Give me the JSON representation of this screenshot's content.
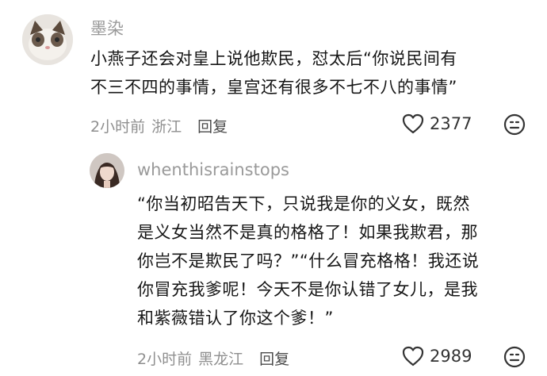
{
  "comment": {
    "username": "墨染",
    "text_lines": [
      "小燕子还会对皇上说他欺民，怼太后“你说民间有",
      "不三不四的事情，皇宫还有很多不七不八的事情”"
    ],
    "time": "2小时前",
    "location": "浙江",
    "reply_label": "回复",
    "like_count": "2377",
    "avatar_icon": "cat-avatar",
    "like_icon": "heart-outline-icon",
    "dislike_icon": "frown-face-icon"
  },
  "reply": {
    "username": "whenthisrainstops",
    "text_lines": [
      "“你当初昭告天下，只说我是你的义女，既然",
      "是义女当然不是真的格格了！如果我欺君，那",
      "你岂不是欺民了吗？”“什么冒充格格！我还说",
      "你冒充我爹呢！今天不是你认错了女儿，是我",
      "和紫薇错认了你这个爹！”"
    ],
    "time": "2小时前",
    "location": "黑龙江",
    "reply_label": "回复",
    "like_count": "2989",
    "avatar_icon": "person-avatar",
    "like_icon": "heart-outline-icon",
    "dislike_icon": "frown-face-icon"
  },
  "colors": {
    "background": "#ffffff",
    "text": "#161616",
    "meta": "#8f8f8f"
  }
}
